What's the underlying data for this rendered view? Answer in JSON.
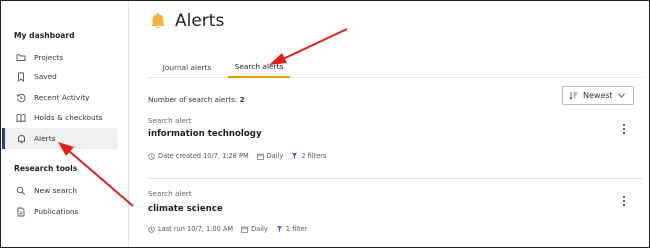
{
  "sidebar": {
    "section1_title": "My dashboard",
    "items": [
      {
        "label": "Projects",
        "icon": "folder-icon"
      },
      {
        "label": "Saved",
        "icon": "bookmark-icon"
      },
      {
        "label": "Recent Activity",
        "icon": "history-icon"
      },
      {
        "label": "Holds & checkouts",
        "icon": "book-icon"
      },
      {
        "label": "Alerts",
        "icon": "bell-icon",
        "active": true
      }
    ],
    "section2_title": "Research tools",
    "tools": [
      {
        "label": "New search",
        "icon": "search-icon"
      },
      {
        "label": "Publications",
        "icon": "document-icon"
      }
    ]
  },
  "page": {
    "title": "Alerts",
    "title_icon": "bell-icon",
    "accent_color": "#e0a100"
  },
  "tabs": [
    {
      "label": "Journal alerts",
      "active": false
    },
    {
      "label": "Search alerts",
      "active": true
    }
  ],
  "count": {
    "label": "Number of search alerts:",
    "value": "2"
  },
  "sort": {
    "selected": "Newest"
  },
  "alerts": [
    {
      "kind": "Search alert",
      "name": "information technology",
      "date": "Date created 10/7, 1:28 PM",
      "frequency": "Daily",
      "filters": "2 filters"
    },
    {
      "kind": "Search alert",
      "name": "climate science",
      "date": "Last run 10/7, 1:00 AM",
      "frequency": "Daily",
      "filters": "1 filter"
    }
  ],
  "annotation_color": "#e0201b"
}
